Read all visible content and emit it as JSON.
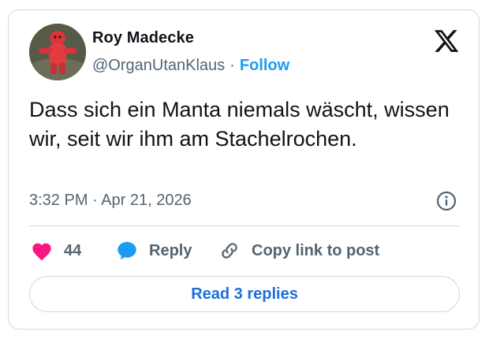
{
  "author": {
    "display_name": "Roy Madecke",
    "handle": "@OrganUtanKlaus",
    "separator": "·",
    "follow_label": "Follow",
    "avatar_icon": "red-plush-toy-avatar"
  },
  "brand_icon": "x-logo-icon",
  "tweet": {
    "text": "Dass sich ein Manta niemals wäscht, wissen wir, seit wir ihm am Stachelrochen.",
    "timestamp": "3:32 PM · Apr 21, 2026"
  },
  "actions": {
    "like_count": "44",
    "reply_label": "Reply",
    "copy_link_label": "Copy link to post"
  },
  "read_replies_label": "Read 3 replies",
  "colors": {
    "accent": "#1d9bf0",
    "like": "#f91880",
    "reply_bubble": "#1d9bf0",
    "muted_text": "#536471",
    "border": "#cfd9de"
  }
}
